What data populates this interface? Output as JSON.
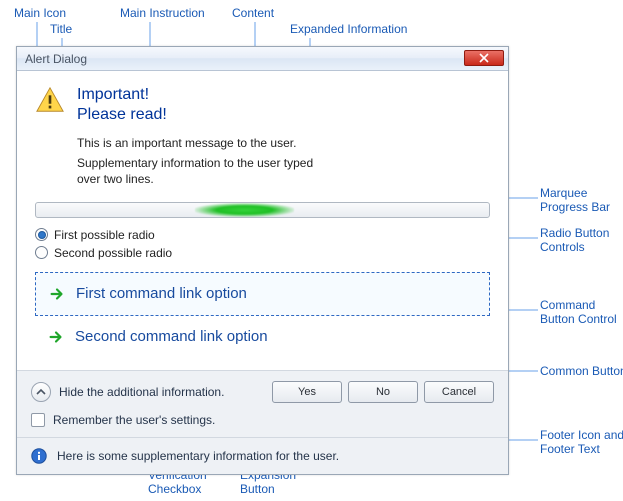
{
  "callouts": {
    "main_icon": "Main Icon",
    "title": "Title",
    "main_instruction": "Main Instruction",
    "content": "Content",
    "expanded_information": "Expanded Information",
    "marquee": "Marquee\nProgress Bar",
    "radio_controls": "Radio Button\nControls",
    "command_button": "Command\nButton Control",
    "common_buttons": "Common Buttons",
    "footer": "Footer Icon and\nFooter Text",
    "verification": "Verification\nCheckbox",
    "expansion": "Expansion\nButton"
  },
  "dialog": {
    "title": "Alert Dialog",
    "main_instruction_line1": "Important!",
    "main_instruction_line2": "Please read!",
    "content_text": "This is an important message to the user.",
    "supplementary_text": "Supplementary information to the user typed over two lines.",
    "radios": [
      {
        "label": "First possible radio",
        "checked": true
      },
      {
        "label": "Second possible radio",
        "checked": false
      }
    ],
    "command_links": [
      {
        "label": "First command link option",
        "selected": true
      },
      {
        "label": "Second command link option",
        "selected": false
      }
    ],
    "expansion_label": "Hide the additional information.",
    "verification_label": "Remember the user's settings.",
    "buttons": {
      "yes": "Yes",
      "no": "No",
      "cancel": "Cancel"
    },
    "footer_text": "Here is some supplementary information for the user."
  }
}
